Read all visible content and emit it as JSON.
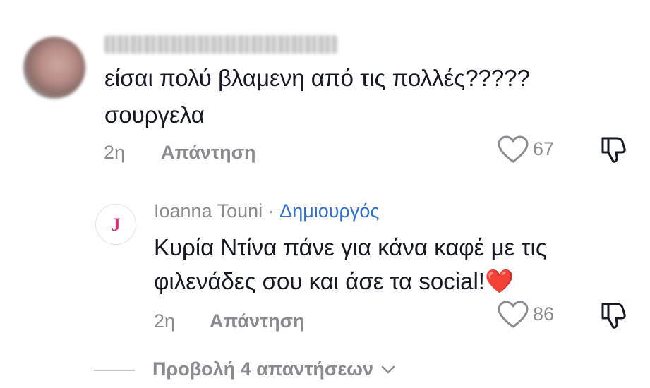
{
  "colors": {
    "text": "#161823",
    "muted": "#8a8b91",
    "creator": "#2f6fd4",
    "avatar_letter": "#d6307c",
    "heart_emoji": "#e0281e"
  },
  "comments": [
    {
      "text_line1": "είσαι πολύ βλαμενη από τις πολλές?????",
      "text_line2": "σουργελα",
      "time": "2η",
      "reply_label": "Απάντηση",
      "likes": "67",
      "like_icon": "heart-outline-icon",
      "dislike_icon": "thumbs-down-icon"
    }
  ],
  "reply": {
    "avatar_letter": "J",
    "author": "Ioanna Touni",
    "separator": " · ",
    "creator_label": "Δημιουργός",
    "text_line1": "Κυρία Ντίνα πάνε για κάνα καφέ με τις",
    "text_line2": "φιλενάδες σου και άσε τα social!",
    "emoji": "❤️",
    "time": "2η",
    "reply_label": "Απάντηση",
    "likes": "86",
    "like_icon": "heart-outline-icon",
    "dislike_icon": "thumbs-down-icon"
  },
  "view_replies": {
    "label": "Προβολή 4 απαντήσεων",
    "icon": "chevron-down-icon"
  }
}
